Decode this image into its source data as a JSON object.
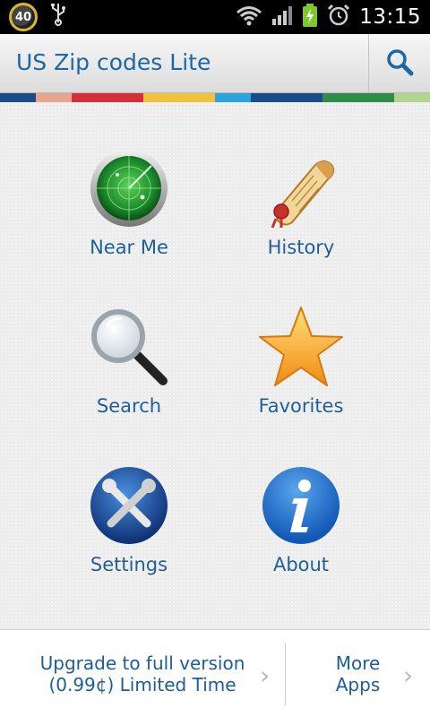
{
  "status_bar": {
    "badge_text": "40",
    "usb_icon": "usb-icon",
    "wifi_icon": "wifi-icon",
    "signal_icon": "signal-icon",
    "battery_icon": "battery-charging-icon",
    "alarm_icon": "alarm-clock-icon",
    "time": "13:15"
  },
  "action_bar": {
    "title": "US Zip codes Lite",
    "search_icon": "search-icon",
    "title_color": "#1c67a8"
  },
  "stripe_colors": [
    "#1a4b8c",
    "#e8a58e",
    "#d5303a",
    "#d5303a",
    "#f2c23c",
    "#f2c23c",
    "#2ca3dc",
    "#1a4b8c",
    "#1a4b8c",
    "#2e8d48",
    "#2e8d48",
    "#b3d38f"
  ],
  "menu": {
    "items": [
      {
        "label": "Near Me",
        "icon": "radar-icon"
      },
      {
        "label": "History",
        "icon": "scroll-icon"
      },
      {
        "label": "Search",
        "icon": "magnifier-icon"
      },
      {
        "label": "Favorites",
        "icon": "star-icon"
      },
      {
        "label": "Settings",
        "icon": "tools-icon"
      },
      {
        "label": "About",
        "icon": "info-icon"
      }
    ],
    "label_color": "#1d5d9b"
  },
  "bottom_bar": {
    "upgrade_line1": "Upgrade to full version",
    "upgrade_line2": "(0.99¢) Limited Time",
    "more_line1": "More",
    "more_line2": "Apps",
    "chevron": "›"
  }
}
